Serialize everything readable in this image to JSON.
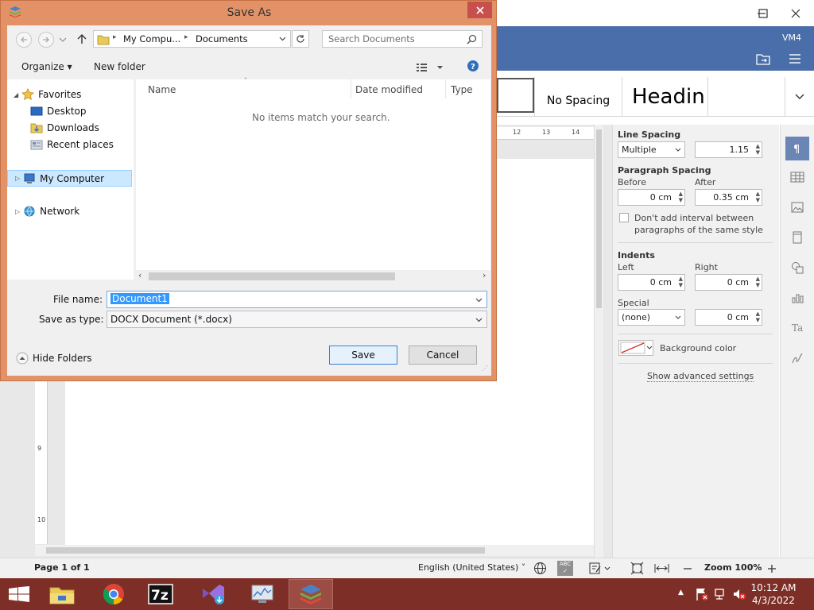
{
  "app": {
    "vm_label": "VM4",
    "styles": [
      "No Spacing",
      "Headin"
    ],
    "ruler_ticks": [
      "12",
      "13",
      "14"
    ],
    "ruler_left_ticks": [
      "9",
      "10"
    ],
    "status": {
      "page": "Page 1 of 1",
      "language": "English (United States)",
      "zoom": "Zoom 100%"
    },
    "panel": {
      "line_spacing_title": "Line Spacing",
      "line_spacing_mode": "Multiple",
      "line_spacing_value": "1.15",
      "paragraph_spacing_title": "Paragraph Spacing",
      "before_label": "Before",
      "before_value": "0 cm",
      "after_label": "After",
      "after_value": "0.35 cm",
      "no_interval_label": "Don't add interval between paragraphs of the same style",
      "indents_title": "Indents",
      "left_label": "Left",
      "left_value": "0 cm",
      "right_label": "Right",
      "right_value": "0 cm",
      "special_label": "Special",
      "special_mode": "(none)",
      "special_value": "0 cm",
      "background_color_label": "Background color",
      "advanced_link": "Show advanced settings"
    }
  },
  "dialog": {
    "title": "Save As",
    "breadcrumb": [
      "My Compu...",
      "Documents"
    ],
    "search_placeholder": "Search Documents",
    "toolbar": {
      "organize": "Organize",
      "new_folder": "New folder"
    },
    "tree": {
      "favorites": "Favorites",
      "desktop": "Desktop",
      "downloads": "Downloads",
      "recent_places": "Recent places",
      "my_computer": "My Computer",
      "network": "Network"
    },
    "columns": [
      "Name",
      "Date modified",
      "Type"
    ],
    "empty_message": "No items match your search.",
    "file_name_label": "File name:",
    "file_name_value": "Document1",
    "save_as_type_label": "Save as type:",
    "save_as_type_value": "DOCX Document (*.docx)",
    "hide_folders": "Hide Folders",
    "save_button": "Save",
    "cancel_button": "Cancel"
  },
  "taskbar": {
    "time": "10:12 AM",
    "date": "4/3/2022"
  },
  "colors": {
    "dialog_frame": "#e39267",
    "app_header": "#4a6ea9",
    "taskbar": "#7d2f27",
    "selection": "#3399ff"
  }
}
